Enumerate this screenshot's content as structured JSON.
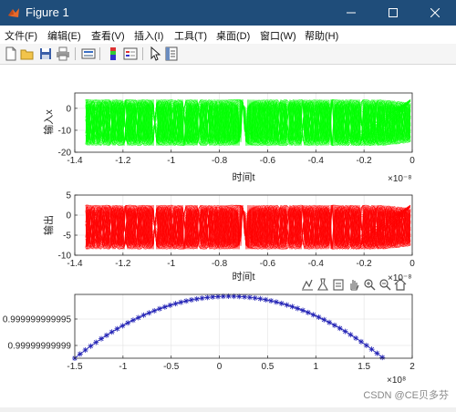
{
  "window": {
    "title": "Figure 1",
    "minimize_icon": "minimize-icon",
    "maximize_icon": "maximize-icon",
    "close_icon": "close-icon"
  },
  "menu": [
    "文件(F)",
    "编辑(E)",
    "查看(V)",
    "插入(I)",
    "工具(T)",
    "桌面(D)",
    "窗口(W)",
    "帮助(H)"
  ],
  "toolbar_icons": [
    "new-figure-icon",
    "open-icon",
    "save-icon",
    "print-icon",
    "link-icon",
    "colorbar-icon",
    "legend-icon",
    "edit-plot-icon",
    "property-inspector-icon"
  ],
  "axes_toolbar_icons": [
    "brush-icon",
    "data-tip-icon",
    "save-axes-icon",
    "pan-icon",
    "zoom-in-icon",
    "zoom-out-icon",
    "home-icon"
  ],
  "colors": {
    "input_series": "#00ff00",
    "output_series": "#ff0000",
    "third_series": "#1f1fb4",
    "titlebar": "#1f4d7a"
  },
  "watermark": "CSDN @CE贝多芬",
  "chart_data": [
    {
      "type": "line",
      "series": [
        {
          "values_description": "",
          "color": "#00ff00"
        }
      ],
      "ylabel": "输入x",
      "xlabel": "时间t",
      "x_exponent": "×10⁻⁸",
      "xlim": [
        -1.4e-08,
        0
      ],
      "ylim": [
        -20,
        7
      ],
      "xticks": [
        "-1.4",
        "-1.2",
        "-1",
        "-0.8",
        "-0.6",
        "-0.4",
        "-0.2",
        "0"
      ],
      "yticks": [
        "-20",
        "-10",
        "0"
      ],
      "band_min": -17,
      "band_max": 4,
      "grid": true
    },
    {
      "type": "line",
      "series": [
        {
          "color": "#ff0000"
        }
      ],
      "ylabel": "输出",
      "xlabel": "时间t",
      "x_exponent": "×10⁻⁸",
      "xlim": [
        -1.4e-08,
        0
      ],
      "ylim": [
        -10,
        5
      ],
      "xticks": [
        "-1.4",
        "-1.2",
        "-1",
        "-0.8",
        "-0.6",
        "-0.4",
        "-0.2",
        "0"
      ],
      "yticks": [
        "-10",
        "-5",
        "0",
        "5"
      ],
      "band_min": -8.5,
      "band_max": 2.5,
      "grid": true
    },
    {
      "type": "line",
      "series": [
        {
          "color": "#1f1fb4",
          "marker": "*"
        }
      ],
      "xlabel": "",
      "ylabel": "",
      "x_exponent": "×10⁸",
      "xlim": [
        -1.5,
        2
      ],
      "xticks": [
        "-1.5",
        "-1",
        "-0.5",
        "0",
        "0.5",
        "1",
        "1.5",
        "2"
      ],
      "yticks": [
        "0.999999999995",
        "0.99999999999"
      ],
      "x_range_data": [
        -1.5,
        1.7
      ],
      "peak_x": 0.1,
      "grid": true
    }
  ]
}
